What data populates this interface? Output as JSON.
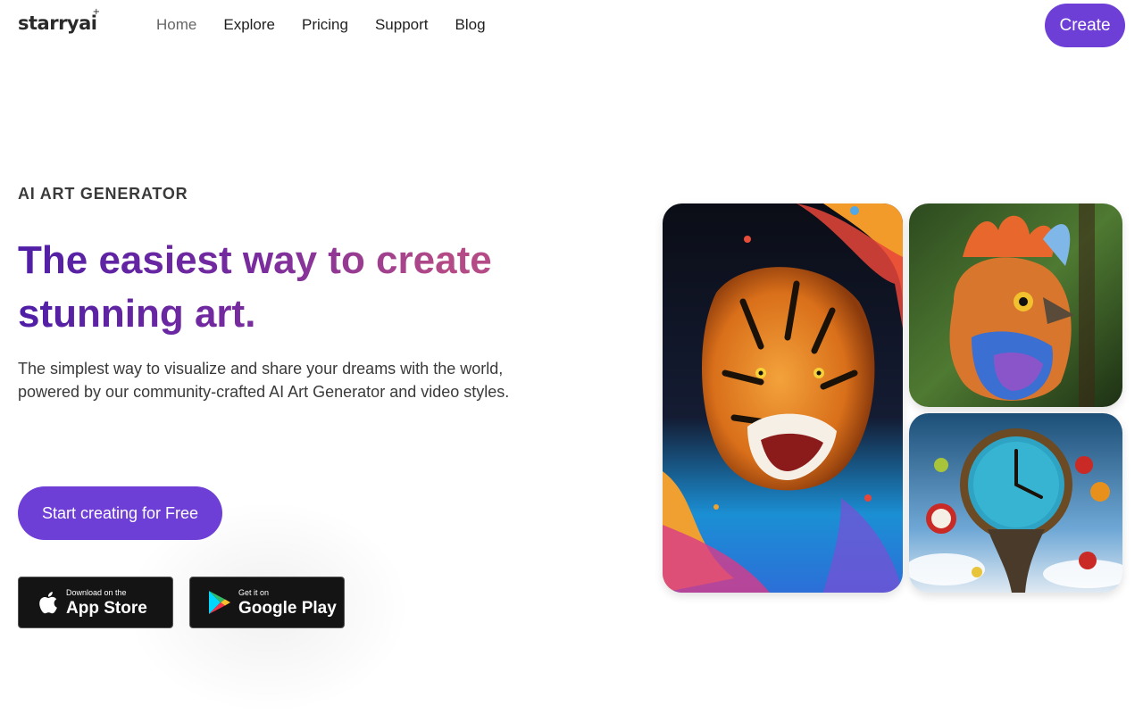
{
  "header": {
    "logo": "starryai",
    "nav": [
      "Home",
      "Explore",
      "Pricing",
      "Support",
      "Blog"
    ],
    "create_label": "Create"
  },
  "hero": {
    "eyebrow": "AI ART GENERATOR",
    "headline": "The easiest way to create stunning art.",
    "subtext": "The simplest way to visualize and share your dreams with the world, powered by our community-crafted AI Art Generator and video styles.",
    "cta_label": "Start creating for Free"
  },
  "stores": {
    "apple_small": "Download on the",
    "apple_big": "App Store",
    "google_small": "Get it on",
    "google_big": "Google Play"
  },
  "gallery": [
    "tiger-image",
    "bird-image",
    "clock-image"
  ],
  "colors": {
    "accent": "#6e3fd6",
    "headline_start": "#4f1ea6",
    "headline_end": "#b44b86"
  }
}
